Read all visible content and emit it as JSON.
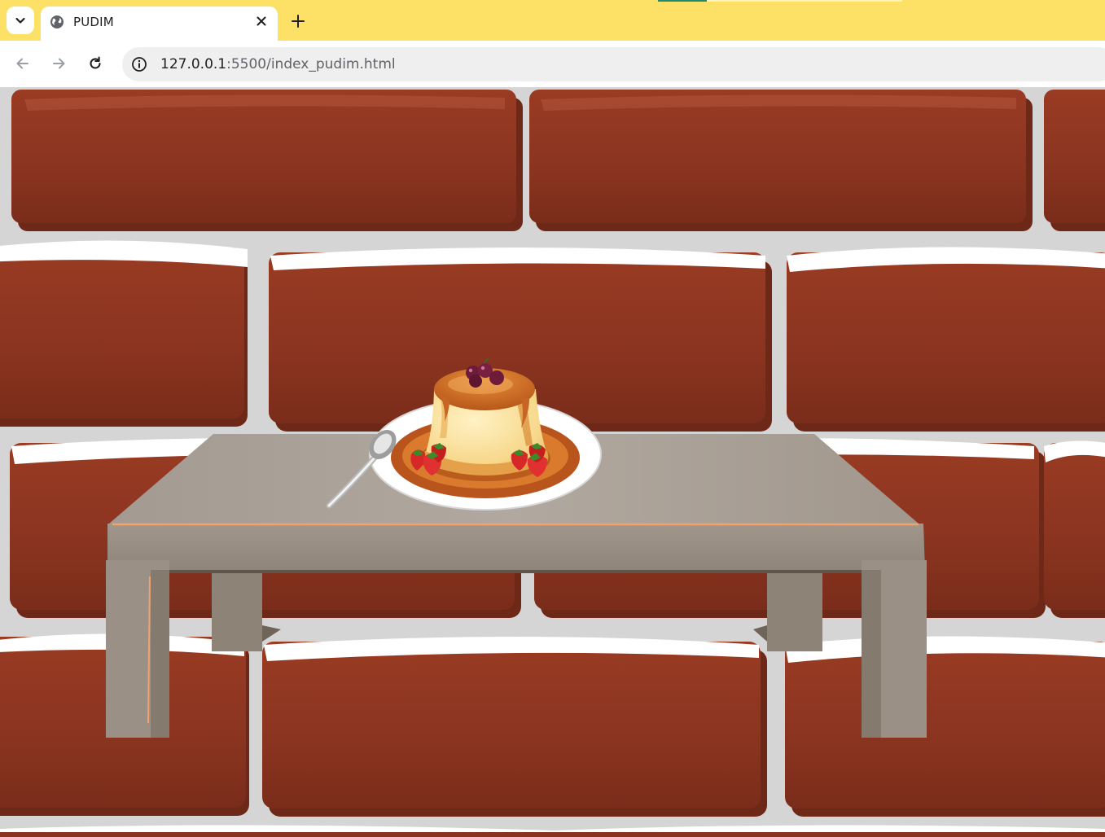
{
  "browser": {
    "tab_list_icon": "chevron-down-icon",
    "tabs": [
      {
        "title": "PUDIM",
        "favicon": "globe-icon",
        "close_icon": "close-icon"
      }
    ],
    "new_tab_icon": "plus-icon",
    "nav": {
      "back_icon": "arrow-left-icon",
      "forward_icon": "arrow-right-icon",
      "reload_icon": "reload-icon"
    },
    "address_bar": {
      "site_info_icon": "info-icon",
      "host": "127.0.0.1",
      "path": ":5500/index_pudim.html"
    }
  },
  "colors": {
    "tab_strip": "#fde066",
    "brick": "#8a3420",
    "mortar": "#d5d5d5",
    "snow": "#ffffff",
    "table": "#a59a8e"
  },
  "scene": {
    "background": "red brick wall with snow",
    "objects": [
      "table",
      "plate",
      "pudding",
      "cherries",
      "strawberries",
      "spoon"
    ]
  }
}
